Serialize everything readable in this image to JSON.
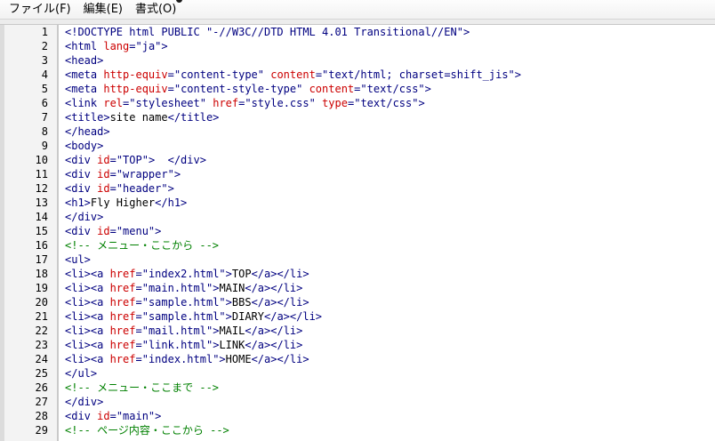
{
  "menu": {
    "items": [
      "ファイル(F)",
      "編集(E)",
      "書式(O)"
    ]
  },
  "colors": {
    "tag": "#000080",
    "attr": "#cc0000",
    "value": "#000080",
    "comment": "#008000",
    "text": "#000000"
  },
  "lines": [
    {
      "no": "1",
      "tokens": [
        [
          "tag",
          "<!DOCTYPE html PUBLIC "
        ],
        [
          "val",
          "\"-//W3C//DTD HTML 4.01 Transitional//EN\""
        ],
        [
          "tag",
          ">"
        ]
      ]
    },
    {
      "no": "2",
      "tokens": [
        [
          "tag",
          "<html "
        ],
        [
          "attr",
          "lang"
        ],
        [
          "tag",
          "="
        ],
        [
          "val",
          "\"ja\""
        ],
        [
          "tag",
          ">"
        ]
      ]
    },
    {
      "no": "3",
      "tokens": [
        [
          "tag",
          "<head>"
        ]
      ]
    },
    {
      "no": "4",
      "tokens": [
        [
          "tag",
          "<meta "
        ],
        [
          "attr",
          "http-equiv"
        ],
        [
          "tag",
          "="
        ],
        [
          "val",
          "\"content-type\""
        ],
        [
          "tag",
          " "
        ],
        [
          "attr",
          "content"
        ],
        [
          "tag",
          "="
        ],
        [
          "val",
          "\"text/html; charset=shift_jis\""
        ],
        [
          "tag",
          ">"
        ]
      ]
    },
    {
      "no": "5",
      "tokens": [
        [
          "tag",
          "<meta "
        ],
        [
          "attr",
          "http-equiv"
        ],
        [
          "tag",
          "="
        ],
        [
          "val",
          "\"content-style-type\""
        ],
        [
          "tag",
          " "
        ],
        [
          "attr",
          "content"
        ],
        [
          "tag",
          "="
        ],
        [
          "val",
          "\"text/css\""
        ],
        [
          "tag",
          ">"
        ]
      ]
    },
    {
      "no": "6",
      "tokens": [
        [
          "tag",
          "<link "
        ],
        [
          "attr",
          "rel"
        ],
        [
          "tag",
          "="
        ],
        [
          "val",
          "\"stylesheet\""
        ],
        [
          "tag",
          " "
        ],
        [
          "attr",
          "href"
        ],
        [
          "tag",
          "="
        ],
        [
          "val",
          "\"style.css\""
        ],
        [
          "tag",
          " "
        ],
        [
          "attr",
          "type"
        ],
        [
          "tag",
          "="
        ],
        [
          "val",
          "\"text/css\""
        ],
        [
          "tag",
          ">"
        ]
      ]
    },
    {
      "no": "7",
      "tokens": [
        [
          "tag",
          "<title>"
        ],
        [
          "text",
          "site name"
        ],
        [
          "tag",
          "</title>"
        ]
      ]
    },
    {
      "no": "8",
      "tokens": [
        [
          "tag",
          "</head>"
        ]
      ]
    },
    {
      "no": "9",
      "tokens": [
        [
          "tag",
          "<body>"
        ]
      ]
    },
    {
      "no": "10",
      "tokens": [
        [
          "tag",
          "<div "
        ],
        [
          "attr",
          "id"
        ],
        [
          "tag",
          "="
        ],
        [
          "val",
          "\"TOP\""
        ],
        [
          "tag",
          ">  </div>"
        ]
      ]
    },
    {
      "no": "11",
      "tokens": [
        [
          "tag",
          "<div "
        ],
        [
          "attr",
          "id"
        ],
        [
          "tag",
          "="
        ],
        [
          "val",
          "\"wrapper\""
        ],
        [
          "tag",
          ">"
        ]
      ]
    },
    {
      "no": "12",
      "tokens": [
        [
          "tag",
          "<div "
        ],
        [
          "attr",
          "id"
        ],
        [
          "tag",
          "="
        ],
        [
          "val",
          "\"header\""
        ],
        [
          "tag",
          ">"
        ]
      ]
    },
    {
      "no": "13",
      "tokens": [
        [
          "tag",
          "<h1>"
        ],
        [
          "text",
          "Fly Higher"
        ],
        [
          "tag",
          "</h1>"
        ]
      ]
    },
    {
      "no": "14",
      "tokens": [
        [
          "tag",
          "</div>"
        ]
      ]
    },
    {
      "no": "15",
      "tokens": [
        [
          "tag",
          "<div "
        ],
        [
          "attr",
          "id"
        ],
        [
          "tag",
          "="
        ],
        [
          "val",
          "\"menu\""
        ],
        [
          "tag",
          ">"
        ]
      ]
    },
    {
      "no": "16",
      "tokens": [
        [
          "comment",
          "<!-- メニュー・ここから -->"
        ]
      ]
    },
    {
      "no": "17",
      "tokens": [
        [
          "tag",
          "<ul>"
        ]
      ]
    },
    {
      "no": "18",
      "tokens": [
        [
          "tag",
          "<li><a "
        ],
        [
          "attr",
          "href"
        ],
        [
          "tag",
          "="
        ],
        [
          "val",
          "\"index2.html\""
        ],
        [
          "tag",
          ">"
        ],
        [
          "text",
          "TOP"
        ],
        [
          "tag",
          "</a></li>"
        ]
      ]
    },
    {
      "no": "19",
      "tokens": [
        [
          "tag",
          "<li><a "
        ],
        [
          "attr",
          "href"
        ],
        [
          "tag",
          "="
        ],
        [
          "val",
          "\"main.html\""
        ],
        [
          "tag",
          ">"
        ],
        [
          "text",
          "MAIN"
        ],
        [
          "tag",
          "</a></li>"
        ]
      ]
    },
    {
      "no": "20",
      "tokens": [
        [
          "tag",
          "<li><a "
        ],
        [
          "attr",
          "href"
        ],
        [
          "tag",
          "="
        ],
        [
          "val",
          "\"sample.html\""
        ],
        [
          "tag",
          ">"
        ],
        [
          "text",
          "BBS"
        ],
        [
          "tag",
          "</a></li>"
        ]
      ]
    },
    {
      "no": "21",
      "tokens": [
        [
          "tag",
          "<li><a "
        ],
        [
          "attr",
          "href"
        ],
        [
          "tag",
          "="
        ],
        [
          "val",
          "\"sample.html\""
        ],
        [
          "tag",
          ">"
        ],
        [
          "text",
          "DIARY"
        ],
        [
          "tag",
          "</a></li>"
        ]
      ]
    },
    {
      "no": "22",
      "tokens": [
        [
          "tag",
          "<li><a "
        ],
        [
          "attr",
          "href"
        ],
        [
          "tag",
          "="
        ],
        [
          "val",
          "\"mail.html\""
        ],
        [
          "tag",
          ">"
        ],
        [
          "text",
          "MAIL"
        ],
        [
          "tag",
          "</a></li>"
        ]
      ]
    },
    {
      "no": "23",
      "tokens": [
        [
          "tag",
          "<li><a "
        ],
        [
          "attr",
          "href"
        ],
        [
          "tag",
          "="
        ],
        [
          "val",
          "\"link.html\""
        ],
        [
          "tag",
          ">"
        ],
        [
          "text",
          "LINK"
        ],
        [
          "tag",
          "</a></li>"
        ]
      ]
    },
    {
      "no": "24",
      "tokens": [
        [
          "tag",
          "<li><a "
        ],
        [
          "attr",
          "href"
        ],
        [
          "tag",
          "="
        ],
        [
          "val",
          "\"index.html\""
        ],
        [
          "tag",
          ">"
        ],
        [
          "text",
          "HOME"
        ],
        [
          "tag",
          "</a></li>"
        ]
      ]
    },
    {
      "no": "25",
      "tokens": [
        [
          "tag",
          "</ul>"
        ]
      ]
    },
    {
      "no": "26",
      "tokens": [
        [
          "comment",
          "<!-- メニュー・ここまで -->"
        ]
      ]
    },
    {
      "no": "27",
      "tokens": [
        [
          "tag",
          "</div>"
        ]
      ]
    },
    {
      "no": "28",
      "tokens": [
        [
          "tag",
          "<div "
        ],
        [
          "attr",
          "id"
        ],
        [
          "tag",
          "="
        ],
        [
          "val",
          "\"main\""
        ],
        [
          "tag",
          ">"
        ]
      ]
    },
    {
      "no": "29",
      "tokens": [
        [
          "comment",
          "<!-- ページ内容・ここから -->"
        ]
      ]
    }
  ]
}
